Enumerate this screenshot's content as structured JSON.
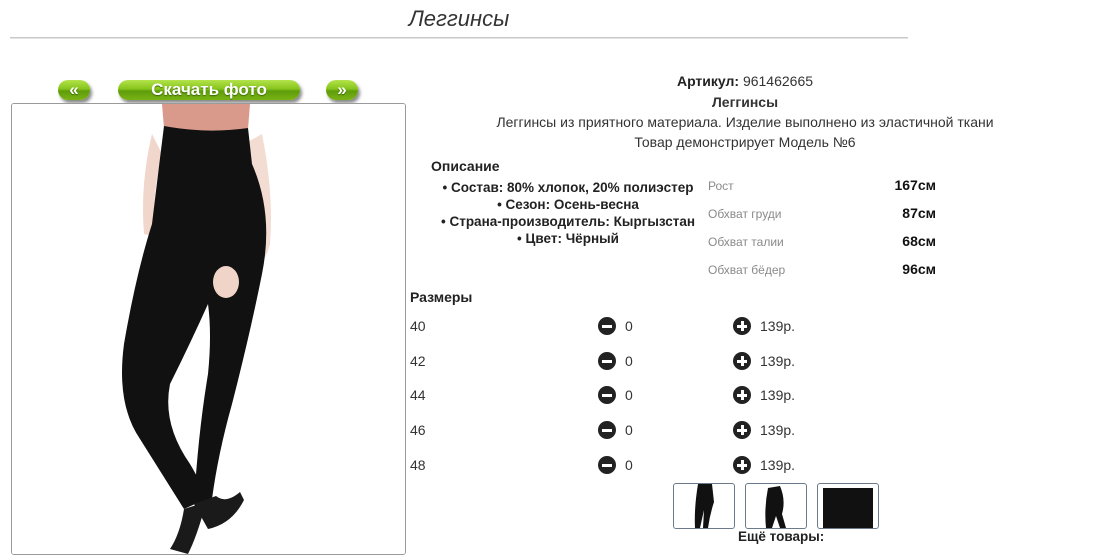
{
  "page_title": "Леггинсы",
  "gallery": {
    "prev_label": "«",
    "download_label": "Скачать фото",
    "next_label": "»"
  },
  "product": {
    "article_label": "Артикул:",
    "article_value": "961462665",
    "name": "Леггинсы",
    "description": "Леггинсы из приятного материала. Изделие выполнено из эластичной ткани",
    "model_note": "Товар демонстрирует Модель №6"
  },
  "details": {
    "title": "Описание",
    "items": [
      "Состав: 80% хлопок, 20% полиэстер",
      "Сезон: Осень-весна",
      "Страна-производитель: Кыргызстан",
      "Цвет: Чёрный"
    ]
  },
  "measurements": [
    {
      "label": "Рост",
      "value": "167см"
    },
    {
      "label": "Обхват груди",
      "value": "87см"
    },
    {
      "label": "Обхват талии",
      "value": "68см"
    },
    {
      "label": "Обхват бёдер",
      "value": "96см"
    }
  ],
  "sizes": {
    "title": "Размеры",
    "rows": [
      {
        "size": "40",
        "qty": "0",
        "price": "139р."
      },
      {
        "size": "42",
        "qty": "0",
        "price": "139р."
      },
      {
        "size": "44",
        "qty": "0",
        "price": "139р."
      },
      {
        "size": "46",
        "qty": "0",
        "price": "139р."
      },
      {
        "size": "48",
        "qty": "0",
        "price": "139р."
      }
    ]
  },
  "more_label": "Ещё товары:",
  "colors": {
    "button_green": "#86c41c",
    "garment": "#111111",
    "top": "#d99a8c"
  }
}
